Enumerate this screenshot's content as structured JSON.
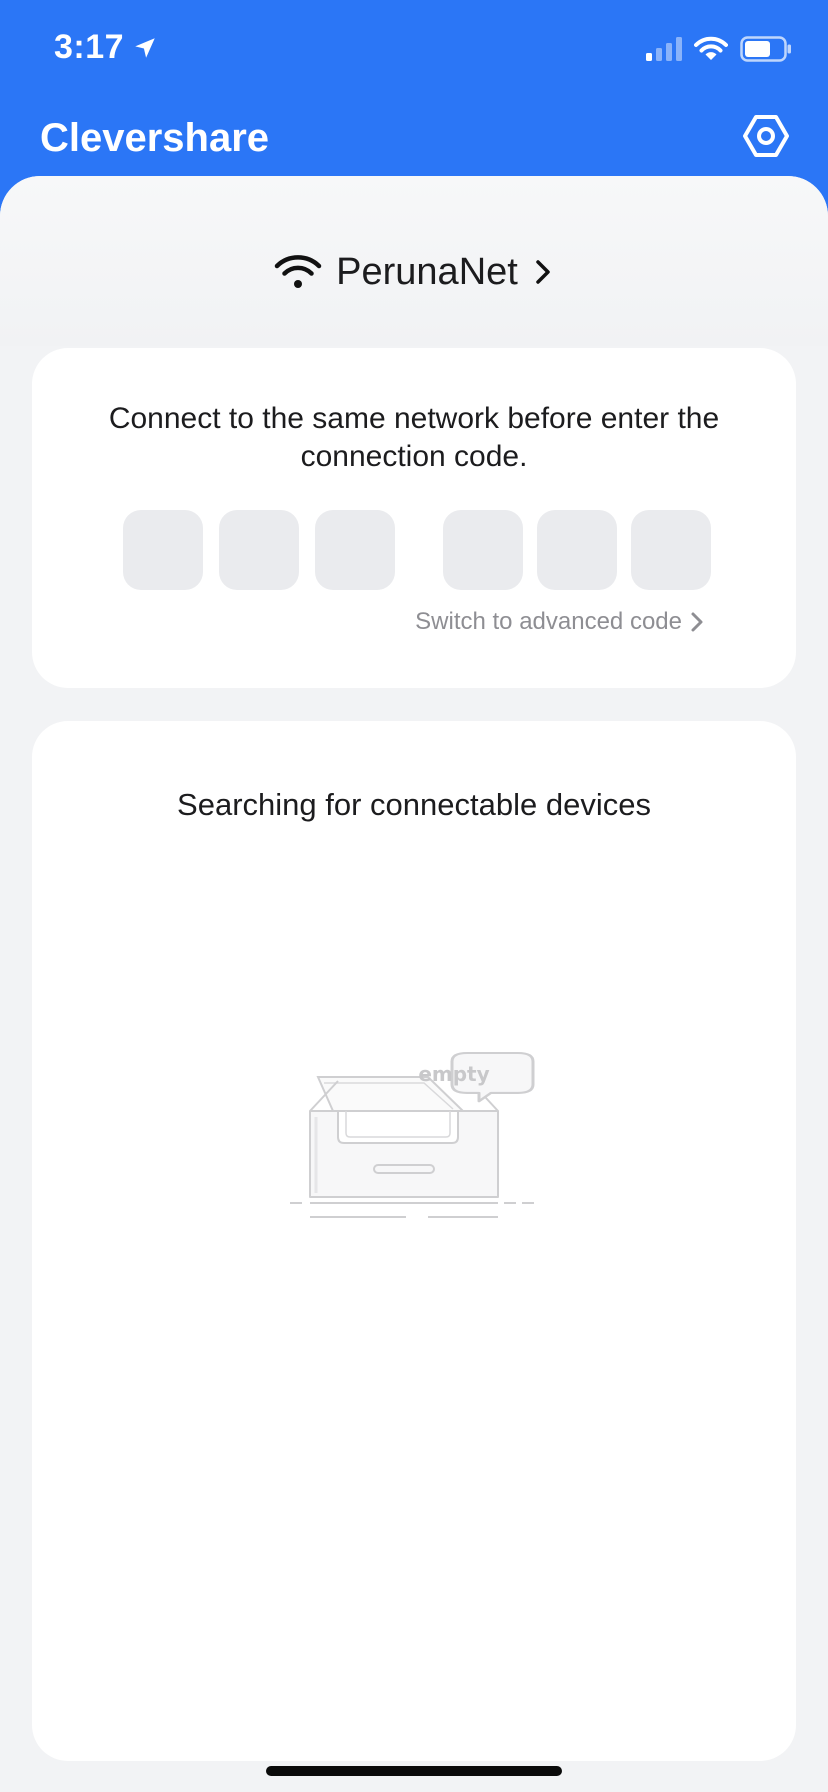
{
  "status_bar": {
    "time": "3:17",
    "location_icon": "location-arrow-icon",
    "signal_icon": "cellular-signal-icon",
    "wifi_icon": "wifi-icon",
    "battery_icon": "battery-icon"
  },
  "header": {
    "title": "Clevershare",
    "settings_icon": "hexagon-settings-icon",
    "background_color": "#2b76f6"
  },
  "network": {
    "name": "PerunaNet",
    "wifi_icon": "wifi-icon",
    "chevron_icon": "chevron-right-icon"
  },
  "connection_code": {
    "instruction": "Connect to the same network before enter the connection code.",
    "digits": [
      "",
      "",
      "",
      "",
      "",
      ""
    ],
    "advanced_link": "Switch to advanced code"
  },
  "devices": {
    "title": "Searching for connectable devices",
    "empty_label": "empty",
    "empty_icon": "empty-inbox-icon"
  }
}
